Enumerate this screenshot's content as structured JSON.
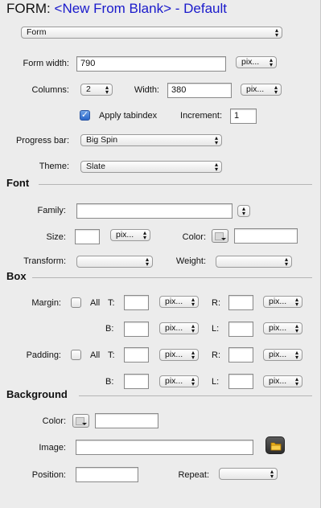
{
  "title": {
    "prefix": "FORM:",
    "name": "<New From Blank> - Default"
  },
  "type_select": "Form",
  "form": {
    "width_label": "Form width:",
    "width_value": "790",
    "width_unit": "pix...",
    "columns_label": "Columns:",
    "columns_value": "2",
    "col_width_label": "Width:",
    "col_width_value": "380",
    "col_width_unit": "pix...",
    "apply_tabindex_label": "Apply tabindex",
    "apply_tabindex_checked": true,
    "increment_label": "Increment:",
    "increment_value": "1",
    "progress_label": "Progress bar:",
    "progress_value": "Big Spin",
    "theme_label": "Theme:",
    "theme_value": "Slate"
  },
  "font": {
    "header": "Font",
    "family_label": "Family:",
    "family_value": "",
    "size_label": "Size:",
    "size_value": "",
    "size_unit": "pix...",
    "color_label": "Color:",
    "color_value": "",
    "transform_label": "Transform:",
    "transform_value": "",
    "weight_label": "Weight:",
    "weight_value": ""
  },
  "box": {
    "header": "Box",
    "margin_label": "Margin:",
    "all_label": "All",
    "t_label": "T:",
    "r_label": "R:",
    "b_label": "B:",
    "l_label": "L:",
    "unit": "pix...",
    "padding_label": "Padding:"
  },
  "background": {
    "header": "Background",
    "color_label": "Color:",
    "color_value": "",
    "image_label": "Image:",
    "image_value": "",
    "position_label": "Position:",
    "position_value": "",
    "repeat_label": "Repeat:",
    "repeat_value": ""
  },
  "icons": {
    "select_arrows": "up-down-arrows-icon",
    "folder": "folder-icon",
    "check": "checkmark-icon"
  }
}
